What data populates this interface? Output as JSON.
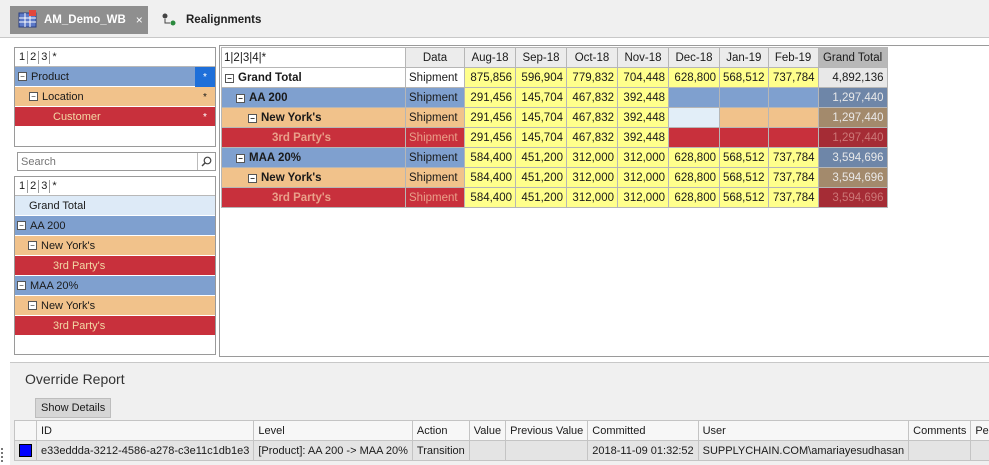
{
  "tabs": [
    {
      "label": "AM_Demo_WB",
      "close": "×"
    },
    {
      "label": "Realignments"
    }
  ],
  "levels_header": [
    "1",
    "2",
    "3",
    "*"
  ],
  "dim_list": {
    "items": [
      {
        "label": "Product",
        "star": "*"
      },
      {
        "label": "Location",
        "star": "*"
      },
      {
        "label": "Customer",
        "star": "*"
      }
    ]
  },
  "search": {
    "placeholder": "Search"
  },
  "tree": {
    "levels": [
      "1",
      "2",
      "3",
      "*"
    ],
    "items": [
      "Grand Total",
      "AA 200",
      "New York's",
      "3rd Party's",
      "MAA 20%",
      "New York's",
      "3rd Party's"
    ]
  },
  "grid": {
    "levels": [
      "1",
      "2",
      "3",
      "4",
      "*"
    ],
    "data_header": "Data",
    "columns": [
      "Aug-18",
      "Sep-18",
      "Oct-18",
      "Nov-18",
      "Dec-18",
      "Jan-19",
      "Feb-19"
    ],
    "grand_total_header": "Grand Total",
    "rows": [
      {
        "label": "Grand Total",
        "measure": "Shipment",
        "values": [
          "875,856",
          "596,904",
          "779,832",
          "704,448",
          "628,800",
          "568,512",
          "737,784"
        ],
        "total": "4,892,136"
      },
      {
        "label": "AA 200",
        "measure": "Shipment",
        "values": [
          "291,456",
          "145,704",
          "467,832",
          "392,448",
          "",
          "",
          ""
        ],
        "total": "1,297,440"
      },
      {
        "label": "New  York's",
        "measure": "Shipment",
        "values": [
          "291,456",
          "145,704",
          "467,832",
          "392,448",
          "",
          "",
          ""
        ],
        "total": "1,297,440"
      },
      {
        "label": "3rd  Party's",
        "measure": "Shipment",
        "values": [
          "291,456",
          "145,704",
          "467,832",
          "392,448",
          "",
          "",
          ""
        ],
        "total": "1,297,440"
      },
      {
        "label": "MAA 20%",
        "measure": "Shipment",
        "values": [
          "584,400",
          "451,200",
          "312,000",
          "312,000",
          "628,800",
          "568,512",
          "737,784"
        ],
        "total": "3,594,696"
      },
      {
        "label": "New  York's",
        "measure": "Shipment",
        "values": [
          "584,400",
          "451,200",
          "312,000",
          "312,000",
          "628,800",
          "568,512",
          "737,784"
        ],
        "total": "3,594,696"
      },
      {
        "label": "3rd  Party's",
        "measure": "Shipment",
        "values": [
          "584,400",
          "451,200",
          "312,000",
          "312,000",
          "628,800",
          "568,512",
          "737,784"
        ],
        "total": "3,594,696"
      }
    ]
  },
  "override_report": {
    "title": "Override Report",
    "show_details": "Show Details",
    "columns": [
      "ID",
      "Level",
      "Action",
      "Value",
      "Previous Value",
      "Committed",
      "User",
      "Comments",
      "Period"
    ],
    "rows": [
      {
        "id": "e33eddda-3212-4586-a278-c3e11c1db1e3",
        "level": "[Product]: AA 200 -> MAA 20%",
        "action": "Transition",
        "value": "",
        "previous": "",
        "committed": "2018-11-09 01:32:52",
        "user": "SUPPLYCHAIN.COM\\amariayesudhasan",
        "comments": "",
        "period": ""
      }
    ]
  },
  "colors": {
    "blue": "#7fa0cf",
    "tan": "#f1c28b",
    "red": "#c8303c",
    "yellow": "#ffff8c"
  }
}
